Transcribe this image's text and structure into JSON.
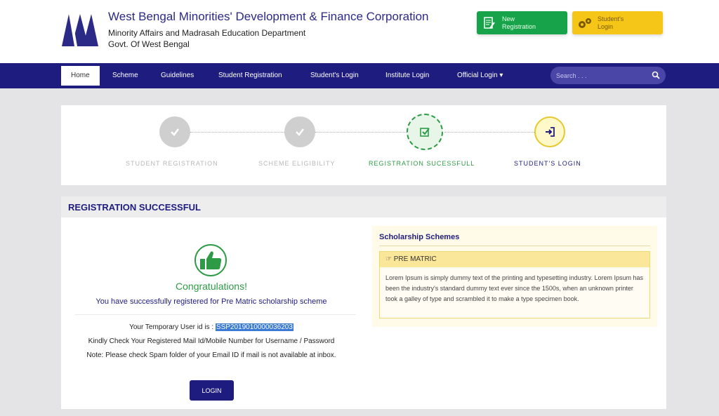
{
  "header": {
    "title": "West Bengal Minorities' Development & Finance Corporation",
    "subtitle1": "Minority Affairs and Madrasah Education Department",
    "subtitle2": "Govt. Of West Bengal",
    "new_registration_line1": "New",
    "new_registration_line2": "Registration",
    "student_login_line1": "Student's",
    "student_login_line2": "Login",
    "colors": {
      "brand": "#1f1c80",
      "green": "#16a34a",
      "yellow": "#f5c518"
    }
  },
  "nav": {
    "items": [
      "Home",
      "Scheme",
      "Guidelines",
      "Student Registration",
      "Student's Login",
      "Institute Login",
      "Official Login"
    ],
    "search_placeholder": "Search . . ."
  },
  "wizard": {
    "steps": [
      {
        "label": "STUDENT REGISTRATION",
        "status": "done"
      },
      {
        "label": "SCHEME ELIGIBILITY",
        "status": "done"
      },
      {
        "label": "REGISTRATION SUCESSFULL",
        "status": "current"
      },
      {
        "label": "STUDENT'S LOGIN",
        "status": "next"
      }
    ]
  },
  "main": {
    "title": "REGISTRATION SUCCESSFUL",
    "congrats": "Congratulations!",
    "success_msg": "You have successfully registered for Pre Matric scholarship scheme",
    "userid_label": "Your Temporary User id is :",
    "userid_value": "SSP2019010000036203",
    "check_mail": "Kindly Check Your Registered Mail Id/Mobile Number for Username / Password",
    "note": "Note: Please check Spam folder of your Email ID if mail is not available at inbox.",
    "login_label": "LOGIN"
  },
  "schemes": {
    "title": "Scholarship Schemes",
    "card_title": "PRE MATRIC",
    "card_body": "Lorem Ipsum is simply dummy text of the printing and typesetting industry. Lorem Ipsum has been the industry's standard dummy text ever since the 1500s, when an unknown printer took a galley of type and scrambled it to make a type specimen book."
  }
}
